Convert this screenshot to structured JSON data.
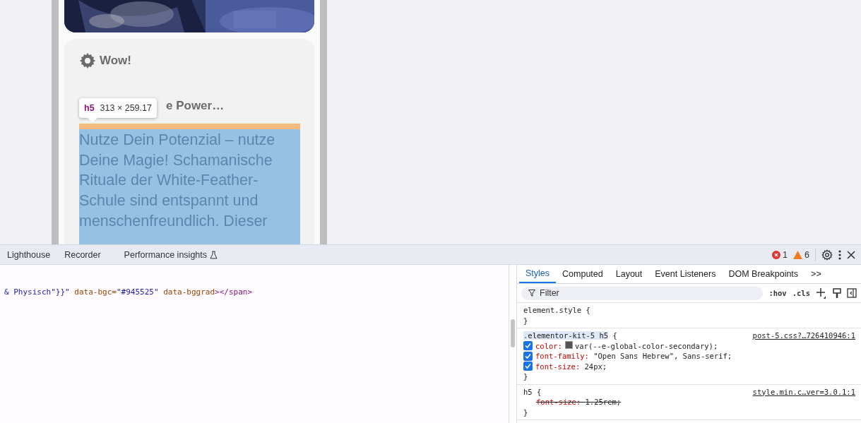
{
  "page_preview": {
    "card": {
      "title": "Wow!",
      "heading": "e Power…",
      "paragraph": "Nutze Dein Potenzial – nutze Deine Magie! Schamanische Rituale der White-Feather-Schule sind entspannt und menschenfreundlich. Dieser"
    },
    "inspect_tooltip": {
      "tag": "h5",
      "size": "313 × 259.17"
    }
  },
  "devtools": {
    "tabs": [
      {
        "label": "Lighthouse",
        "selected": false,
        "experimental": false
      },
      {
        "label": "Recorder",
        "selected": false,
        "experimental": false
      },
      {
        "label": "Performance insights",
        "selected": false,
        "experimental": true
      }
    ],
    "errors": "1",
    "warnings": "6",
    "elements_line": [
      {
        "kind": "value",
        "text": "& Physisch\"}}\""
      },
      {
        "kind": "attr",
        "text": " data-bgc="
      },
      {
        "kind": "value",
        "text": "\"#945525\""
      },
      {
        "kind": "attr",
        "text": " data-bggrad"
      },
      {
        "kind": "tag",
        "text": "></span>"
      }
    ],
    "styles_tabs": [
      {
        "label": "Styles",
        "selected": true
      },
      {
        "label": "Computed",
        "selected": false
      },
      {
        "label": "Layout",
        "selected": false
      },
      {
        "label": "Event Listeners",
        "selected": false
      },
      {
        "label": "DOM Breakpoints",
        "selected": false
      }
    ],
    "more_tabs": ">>",
    "filter": {
      "placeholder": "Filter"
    },
    "toggles": [
      ":hov",
      ".cls"
    ],
    "rules": [
      {
        "selector": "element.style",
        "open": "{",
        "close": "}",
        "highlighted": false
      },
      {
        "selector": ".elementor-kit-5 h5",
        "open": "{",
        "close": "}",
        "highlighted": true,
        "source": "post-5.css?…726410946:1",
        "declarations": [
          {
            "kind": "color",
            "property": "color:",
            "value": "var(--e-global-color-secondary);",
            "checked": true,
            "overridden": false
          },
          {
            "kind": "plain",
            "property": "font-family:",
            "value": "\"Open Sans Hebrew\", Sans-serif;",
            "checked": true,
            "overridden": false
          },
          {
            "kind": "plain",
            "property": "font-size:",
            "value": "24px;",
            "checked": true,
            "overridden": false
          }
        ]
      },
      {
        "selector": "h5",
        "open": "{",
        "close": "}",
        "highlighted": false,
        "source": "style.min.c…ver=3.0.1:1",
        "declarations": [
          {
            "kind": "plain",
            "property": "font-size:",
            "value": "1.25rem;",
            "overridden": true
          }
        ]
      }
    ]
  }
}
